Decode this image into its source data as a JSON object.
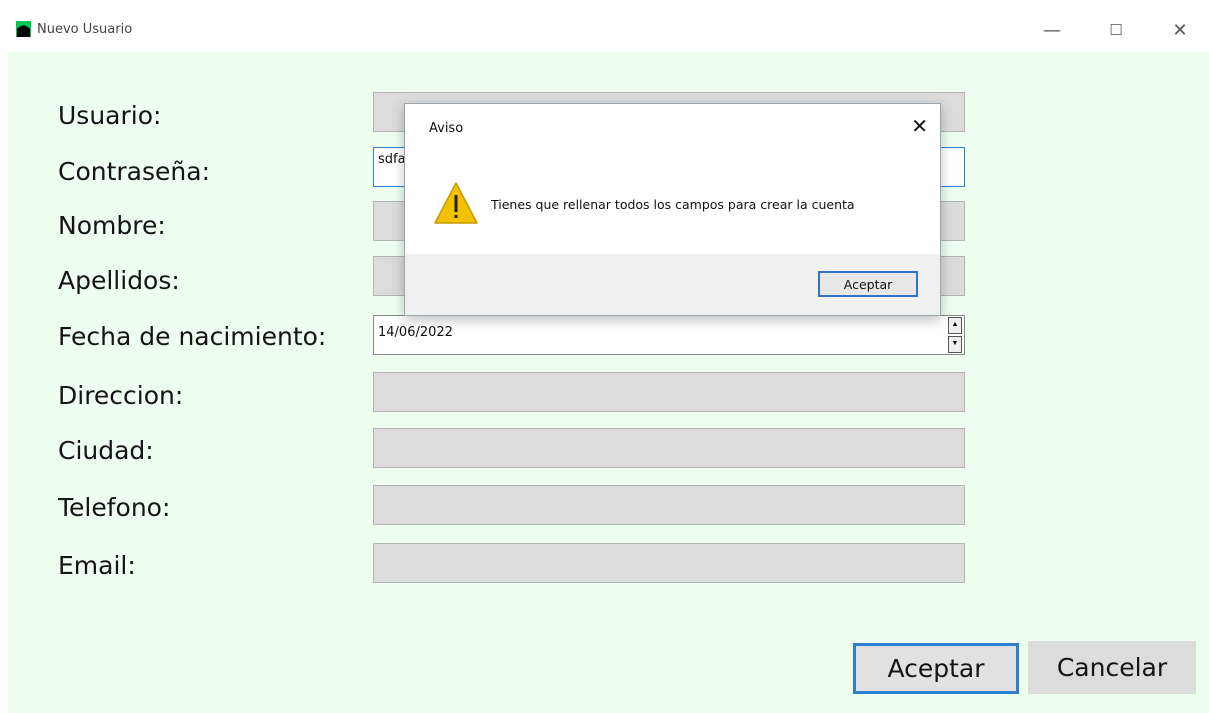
{
  "window": {
    "title": "Nuevo Usuario",
    "minimize": "—",
    "maximize": "☐",
    "close": "✕"
  },
  "form": {
    "fields": [
      {
        "label": "Usuario:",
        "value": ""
      },
      {
        "label": "Contraseña:",
        "value": "sdfa"
      },
      {
        "label": "Nombre:",
        "value": ""
      },
      {
        "label": "Apellidos:",
        "value": ""
      },
      {
        "label": "Fecha de nacimiento:",
        "value": "14/06/2022"
      },
      {
        "label": "Direccion:",
        "value": ""
      },
      {
        "label": "Ciudad:",
        "value": ""
      },
      {
        "label": "Telefono:",
        "value": ""
      },
      {
        "label": "Email:",
        "value": ""
      }
    ],
    "accept_label": "Aceptar",
    "cancel_label": "Cancelar"
  },
  "dialog": {
    "title": "Aviso",
    "close": "✕",
    "message": "Tienes que rellenar todos los campos para crear la cuenta",
    "button": "Aceptar",
    "icon": "warning-icon"
  },
  "colors": {
    "client_bg": "#eefff0",
    "field_bg": "#dcdcdc",
    "focus_border": "#2f7fd1",
    "warning": "#f2c200"
  }
}
